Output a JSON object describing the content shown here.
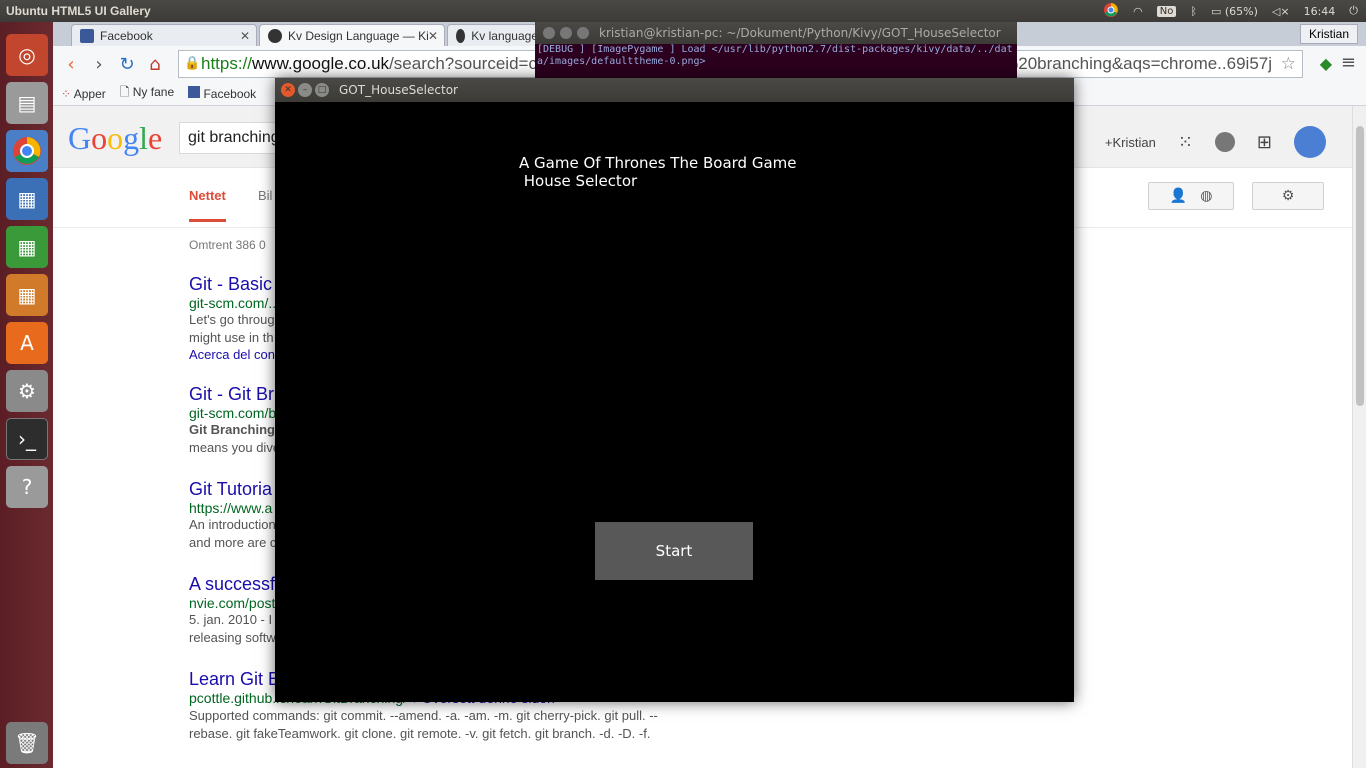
{
  "topbar": {
    "app_title": "Ubuntu HTML5 UI Gallery",
    "keyboard": "No",
    "battery": "(65%)",
    "time": "16:44"
  },
  "launcher": {
    "items": [
      "dash-icon",
      "files-icon",
      "chrome-icon",
      "writer-icon",
      "calc-icon",
      "impress-icon",
      "software-center-icon",
      "settings-icon",
      "terminal-icon",
      "help-icon",
      "trash-icon"
    ]
  },
  "browser": {
    "tabs": [
      {
        "label": "Facebook"
      },
      {
        "label": "Kv Design Language — Kivy"
      },
      {
        "label": "Kv language"
      }
    ],
    "user": "Kristian",
    "address_scheme": "https://",
    "address_host": "www.google.co.uk",
    "address_rest": "/search?sourceid=chrome-",
    "address_tail": "t%20branching&aqs=chrome..69i57j",
    "bookmarks": [
      "Apper",
      "Ny fane",
      "Facebook"
    ]
  },
  "google": {
    "logo": "Google",
    "query": "git branching",
    "user_link": "+Kristian",
    "tab_web": "Nettet",
    "tab_images": "Bil",
    "result_count": "Omtrent 386 0",
    "results": [
      {
        "title": "Git - Basic",
        "url": "git-scm.com/...",
        "s1": "Let's go throug",
        "s2": "might use in th",
        "extra": "Acerca del con"
      },
      {
        "title": "Git - Git Br",
        "url": "git-scm.com/b",
        "s1": "Git Branching",
        "s2": "means you dive"
      },
      {
        "title": "Git Tutoria",
        "url": "https://www.a",
        "s1": "An introduction",
        "s2": "and more are c"
      },
      {
        "title": "A successf",
        "url": "nvie.com/post",
        "s1": "5. jan. 2010 - I",
        "s2": "releasing softw"
      },
      {
        "title": "Learn Git B",
        "url": "pcottle.github.io/learnGitBranching/",
        "translate": "Oversett denne siden",
        "s1": "Supported commands: git commit. --amend. -a. -am. -m. git cherry-pick. git pull. --",
        "s2": "rebase. git fakeTeamwork. git clone. git remote. -v. git fetch. git branch. -d. -D. -f."
      }
    ]
  },
  "terminal": {
    "title": "kristian@kristian-pc: ~/Dokument/Python/Kivy/GOT_HouseSelector",
    "line1": "[DEBUG  ] [ImagePygame ] Load </usr/lib/python2.7/dist-packages/kivy/data/../dat",
    "line2": "a/images/defaulttheme-0.png>"
  },
  "kivy_window": {
    "title": "GOT_HouseSelector",
    "heading": "A Game Of Thrones The Board Game\n House Selector",
    "start_label": "Start"
  }
}
